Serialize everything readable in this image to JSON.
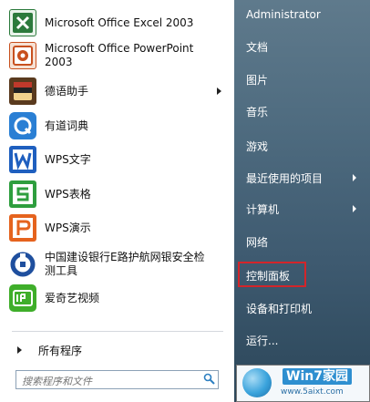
{
  "programs": [
    {
      "label": "Microsoft Office Excel 2003",
      "icon": "excel-icon",
      "color": "#2c7a3c"
    },
    {
      "label": "Microsoft Office PowerPoint 2003",
      "icon": "powerpoint-icon",
      "color": "#c8501e"
    },
    {
      "label": "德语助手",
      "icon": "german-assistant-icon",
      "color": "#8b5a2b",
      "has_submenu": true
    },
    {
      "label": "有道词典",
      "icon": "youdao-dictionary-icon",
      "color": "#2a7fd4"
    },
    {
      "label": "WPS文字",
      "icon": "wps-writer-icon",
      "color": "#1f5fbf",
      "glyph": "W"
    },
    {
      "label": "WPS表格",
      "icon": "wps-spreadsheet-icon",
      "color": "#2e9e3e",
      "glyph": "S"
    },
    {
      "label": "WPS演示",
      "icon": "wps-presentation-icon",
      "color": "#e5631e",
      "glyph": "P"
    },
    {
      "label": "中国建设银行E路护航网银安全检测工具",
      "icon": "ccb-security-icon",
      "color": "#1f4f9e"
    },
    {
      "label": "爱奇艺视频",
      "icon": "iqiyi-icon",
      "color": "#3fae2a"
    }
  ],
  "all_programs": "所有程序",
  "search_placeholder": "搜索程序和文件",
  "right_items": [
    {
      "label": "Administrator"
    },
    {
      "label": "文档"
    },
    {
      "label": "图片"
    },
    {
      "label": "音乐"
    },
    {
      "label": "游戏"
    },
    {
      "label": "最近使用的项目",
      "has_submenu": true
    },
    {
      "label": "计算机",
      "has_submenu": true
    },
    {
      "label": "网络"
    },
    {
      "label": "控制面板",
      "highlighted": true
    },
    {
      "label": "设备和打印机"
    },
    {
      "label": "运行..."
    }
  ],
  "watermark": {
    "title": "Win7家园",
    "url": "www.5aixt.com"
  },
  "colors": {
    "highlight": "#d3252a",
    "right_panel": "#4f6c80"
  }
}
